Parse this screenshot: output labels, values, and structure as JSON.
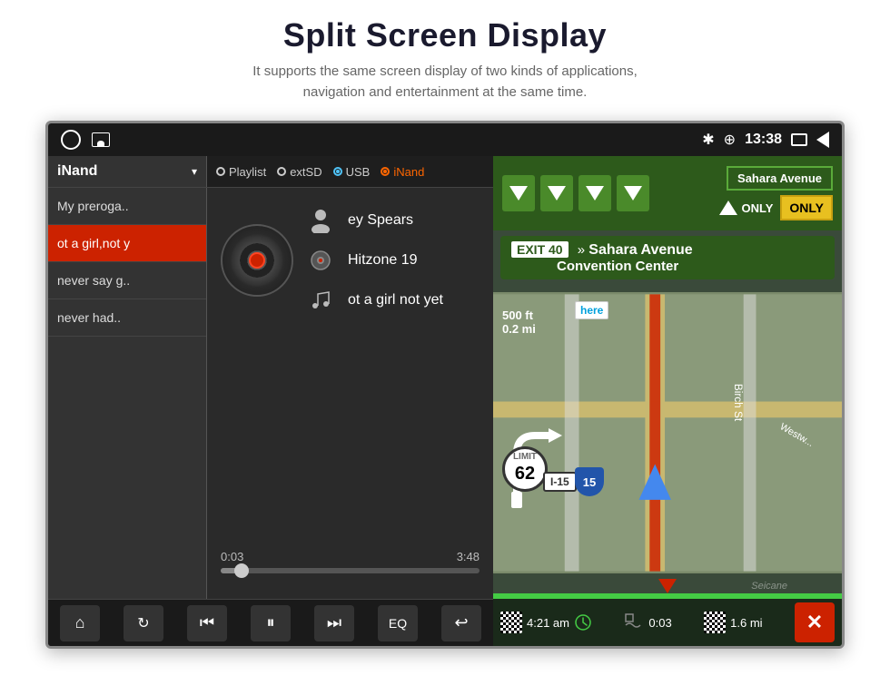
{
  "page": {
    "title": "Split Screen Display",
    "subtitle_line1": "It supports the same screen display of two kinds of applications,",
    "subtitle_line2": "navigation and entertainment at the same time."
  },
  "status_bar": {
    "time": "13:38",
    "bluetooth_icon": "bluetooth",
    "location_icon": "location-pin",
    "window_icon": "window",
    "back_icon": "back-arrow"
  },
  "music": {
    "source_label": "iNand",
    "dropdown_label": "▾",
    "sources": [
      {
        "label": "Playlist",
        "type": "radio"
      },
      {
        "label": "extSD",
        "type": "radio"
      },
      {
        "label": "USB",
        "type": "radio-blue"
      },
      {
        "label": "iNand",
        "type": "radio-orange",
        "active": true
      }
    ],
    "playlist": [
      {
        "title": "My preroga..",
        "active": false
      },
      {
        "title": "ot a girl,not y",
        "active": true
      },
      {
        "title": "never say g..",
        "active": false
      },
      {
        "title": "never had..",
        "active": false
      }
    ],
    "now_playing": {
      "artist": "ey Spears",
      "album": "Hitzone 19",
      "song": "ot a girl not yet"
    },
    "progress": {
      "current": "0:03",
      "total": "3:48",
      "percent": 8
    },
    "controls": [
      {
        "name": "home",
        "icon": "⌂"
      },
      {
        "name": "repeat",
        "icon": "↻"
      },
      {
        "name": "prev",
        "icon": "⏮"
      },
      {
        "name": "play-pause",
        "icon": "⏸"
      },
      {
        "name": "next",
        "icon": "⏭"
      },
      {
        "name": "eq",
        "icon": "EQ"
      },
      {
        "name": "back",
        "icon": "↩"
      }
    ]
  },
  "navigation": {
    "highway_sign": "I-15",
    "exit_number": "EXIT 40",
    "exit_name": "Sahara Avenue",
    "exit_subtitle": "Convention Center",
    "street_label": "Sahara Avenue",
    "only_label": "ONLY",
    "speed_limit": "62",
    "highway_num": "15",
    "route_dist": "0.2 mi",
    "dist_label": "500 ft",
    "here_label": "here",
    "i15_label": "I-15",
    "bottom": {
      "time_arrival": "4:21 am",
      "time_elapsed": "0:03",
      "distance": "1.6 mi"
    },
    "close_label": "✕"
  },
  "watermark": "Seicane"
}
